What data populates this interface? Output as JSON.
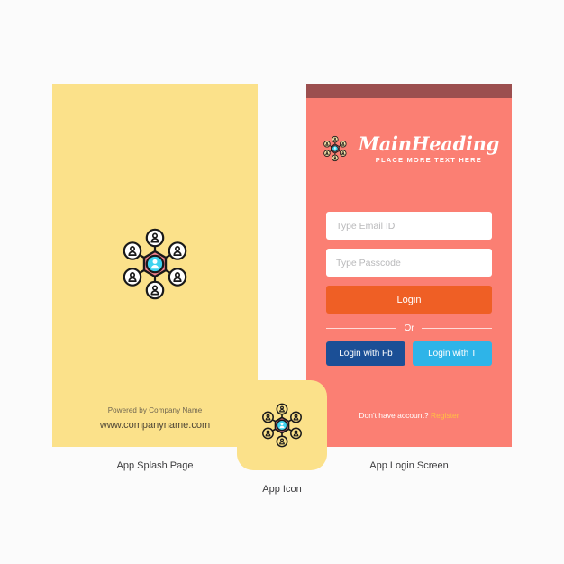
{
  "splash": {
    "panel_color": "#fbe18a",
    "powered_by": "Powered by Company Name",
    "website": "www.companyname.com",
    "caption": "App Splash Page"
  },
  "login": {
    "panel_color": "#fb7f73",
    "status_bar_color": "#9c4f4f",
    "heading": "MainHeading",
    "subheading": "PLACE MORE TEXT HERE",
    "email_placeholder": "Type Email ID",
    "email_value": "",
    "passcode_placeholder": "Type Passcode",
    "passcode_value": "",
    "login_label": "Login",
    "login_color": "#ef5f25",
    "or_label": "Or",
    "facebook_label": "Login with Fb",
    "facebook_color": "#1b4f96",
    "twitter_label": "Login with T",
    "twitter_color": "#2eb4e8",
    "register_prompt": "Don't have account?",
    "register_label": "Register",
    "register_color": "#ffc043",
    "caption": "App Login Screen"
  },
  "app_icon": {
    "tile_color": "#fbe18a",
    "caption": "App Icon"
  },
  "logo": {
    "name": "network-people-icon",
    "hex_fill": "#f2818c",
    "center_circle_fill": "#3fd3ef",
    "node_fill": "#ffffff",
    "stroke": "#191919",
    "node_count": 6
  },
  "page": {
    "background": "#fbfbfb"
  }
}
